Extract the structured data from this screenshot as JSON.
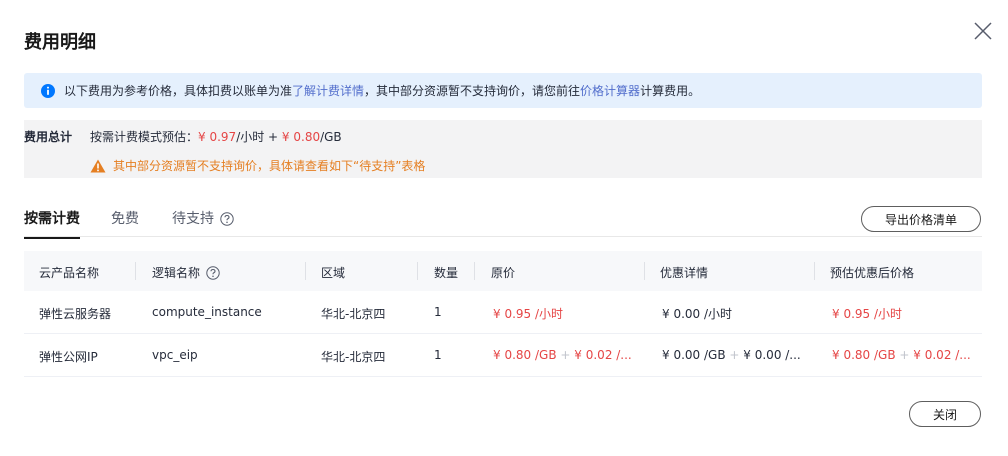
{
  "dialog": {
    "title": "费用明细"
  },
  "info": {
    "text_before": "以下费用为参考价格，具体扣费以账单为准",
    "link1": "了解计费详情",
    "text_middle": "，其中部分资源暂不支持询价，请您前往",
    "link2": "价格计算器",
    "text_after": "计算费用。"
  },
  "summary": {
    "label": "费用总计",
    "prefix": "按需计费模式预估：",
    "hourly_price": "¥ 0.97",
    "hourly_unit": "/小时 + ",
    "traffic_price": "¥ 0.80",
    "traffic_unit": "/GB",
    "warning": "其中部分资源暂不支持询价，具体请查看如下“待支持”表格"
  },
  "tabs": [
    {
      "label": "按需计费"
    },
    {
      "label": "免费"
    },
    {
      "label": "待支持"
    }
  ],
  "toolbar": {
    "export_label": "导出价格清单"
  },
  "table": {
    "headers": [
      "云产品名称",
      "逻辑名称",
      "区域",
      "数量",
      "原价",
      "优惠详情",
      "预估优惠后价格"
    ],
    "rows": [
      {
        "product": "弹性云服务器",
        "logical_name": "compute_instance",
        "region": "华北-北京四",
        "quantity": "1",
        "original_price": "¥ 0.95 /小时",
        "discount": "¥ 0.00 /小时",
        "estimated_price": "¥ 0.95 /小时"
      },
      {
        "product": "弹性公网IP",
        "logical_name": "vpc_eip",
        "region": "华北-北京四",
        "quantity": "1",
        "original_price_a": "¥ 0.80 /GB",
        "original_price_b": "¥ 0.02 /...",
        "discount_a": "¥ 0.00 /GB",
        "discount_b": "¥ 0.00 /...",
        "estimated_price_a": "¥ 0.80 /GB",
        "estimated_price_b": "¥ 0.02 /..."
      }
    ],
    "plus_sign": "+"
  },
  "footer": {
    "close_label": "关闭"
  },
  "colors": {
    "price_red": "#e54545",
    "link_blue": "#526ecc",
    "warning_orange": "#e57f22",
    "info_bg": "#e5f0fd"
  }
}
